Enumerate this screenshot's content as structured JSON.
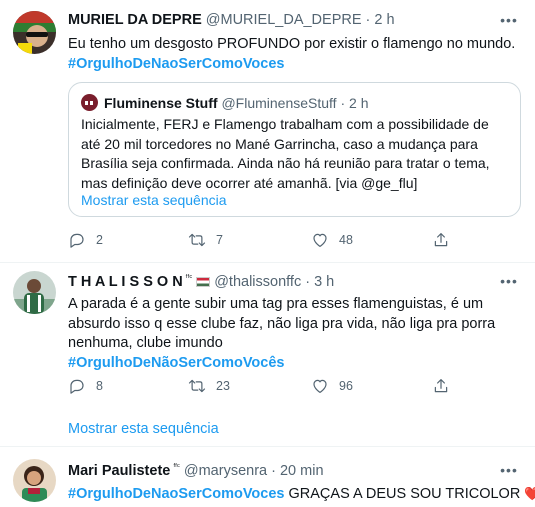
{
  "tweets": [
    {
      "display_name": "MURIEL DA DEPRE",
      "handle": "@MURIEL_DA_DEPRE",
      "time": "· 2 h",
      "text": "Eu tenho um desgosto PROFUNDO por existir o flamengo no mundo.",
      "hashtag": "#OrgulhoDeNaoSerComoVoces",
      "quote": {
        "display_name": "Fluminense Stuff",
        "handle": "@FluminenseStuff",
        "time": "· 2 h",
        "text": "Inicialmente, FERJ e Flamengo trabalham com a possibilidade de até 20 mil torcedores no Mané Garrincha, caso a mudança para Brasília seja confirmada. Ainda não há reunião para tratar o tema, mas definição deve ocorrer até amanhã. [via @ge_flu]",
        "show_thread": "Mostrar esta sequência"
      },
      "replies": "2",
      "retweets": "7",
      "likes": "48"
    },
    {
      "display_name": "T H A L I S S O N",
      "name_suffix": "ᶠᶠᶜ",
      "handle": "@thalissonffc",
      "time": "· 3 h",
      "text": "A parada é a gente subir uma tag pra esses flamenguistas, é um absurdo isso q esse clube faz, não liga pra vida, não liga pra porra nenhuma, clube imundo",
      "hashtag": "#OrgulhoDeNãoSerComoVocês",
      "replies": "8",
      "retweets": "23",
      "likes": "96",
      "show_thread": "Mostrar esta sequência"
    },
    {
      "display_name": "Mari Paulistete",
      "name_suffix": "ᶠᶠᶜ",
      "handle": "@marysenra",
      "time": "· 20 min",
      "hashtag": "#OrgulhoDeNaoSerComoVoces",
      "text": "GRAÇAS A DEUS SOU TRICOLOR",
      "emoji": "❤️💚"
    }
  ],
  "colors": {
    "accent": "#1d9bf0",
    "muted": "#536471",
    "border": "#cfd9de"
  }
}
